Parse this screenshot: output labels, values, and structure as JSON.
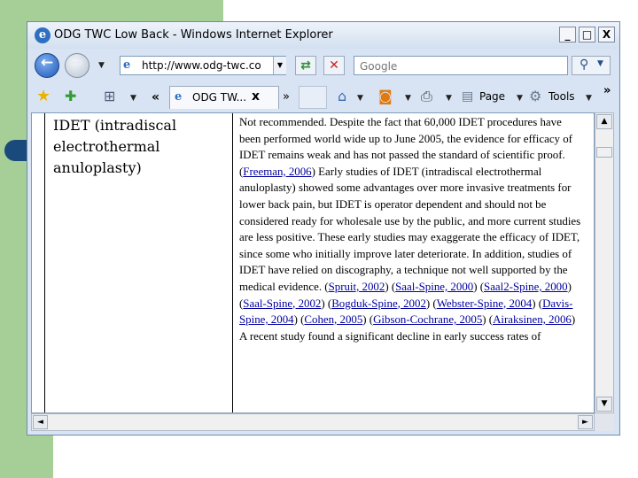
{
  "window": {
    "title": "ODG TWC Low Back - Windows Internet Explorer",
    "minimize_glyph": "_",
    "maximize_glyph": "□",
    "close_glyph": "X"
  },
  "nav": {
    "back_glyph": "←",
    "forward_glyph": "→",
    "address_value": "http://www.odg-twc.co",
    "search_placeholder": "Google"
  },
  "command_bar": {
    "history_glyph": "«",
    "tab_label": "ODG TW...",
    "tab_close_glyph": "x",
    "chevron_glyph": "»",
    "page_label": "Page",
    "tools_label": "Tools",
    "overflow_glyph": "»"
  },
  "content": {
    "row_label": "IDET (intradiscal electrothermal anuloplasty)",
    "text_1": "Not recommended. Despite the fact that 60,000 IDET procedures have been performed world wide up to June 2005, the evidence for efficacy of IDET remains weak and has not passed the standard of scientific proof. (",
    "ref_freeman": "Freeman, 2006",
    "text_2": ") Early studies of IDET (intradiscal electrothermal anuloplasty) showed some advantages over more invasive treatments for lower back pain, but IDET is operator dependent and should not be considered ready for wholesale use by the public, and more current studies are less positive. These early studies may exaggerate the efficacy of IDET, since some who initially improve later deteriorate. In addition, studies of IDET have relied on discography, a technique not well supported by the medical evidence. (",
    "ref_spruit": "Spruit, 2002",
    "sep_1": ") (",
    "ref_saal_2000": "Saal-Spine, 2000",
    "sep_2": ") (",
    "ref_saal2_2000": "Saal2-Spine, 2000",
    "sep_3": ") (",
    "ref_saal_2002": "Saal-Spine, 2002",
    "sep_4": ") (",
    "ref_bogduk": "Bogduk-Spine, 2002",
    "sep_5": ") (",
    "ref_webster": "Webster-Spine, 2004",
    "sep_6": ") (",
    "ref_davis": "Davis-Spine, 2004",
    "sep_7": ") (",
    "ref_cohen": "Cohen, 2005",
    "sep_8": ") (",
    "ref_gibson": "Gibson-Cochrane, 2005",
    "sep_9": ") (",
    "ref_airaksinen": "Airaksinen, 2006",
    "text_3": ") A recent study found a significant decline in early success rates of"
  },
  "scrollbars": {
    "up_glyph": "▲",
    "down_glyph": "▼",
    "left_glyph": "◄",
    "right_glyph": "►"
  },
  "colors": {
    "slide_green": "#a6cf98",
    "bullet_blue": "#1a4a7c",
    "link_blue": "#00009e"
  }
}
